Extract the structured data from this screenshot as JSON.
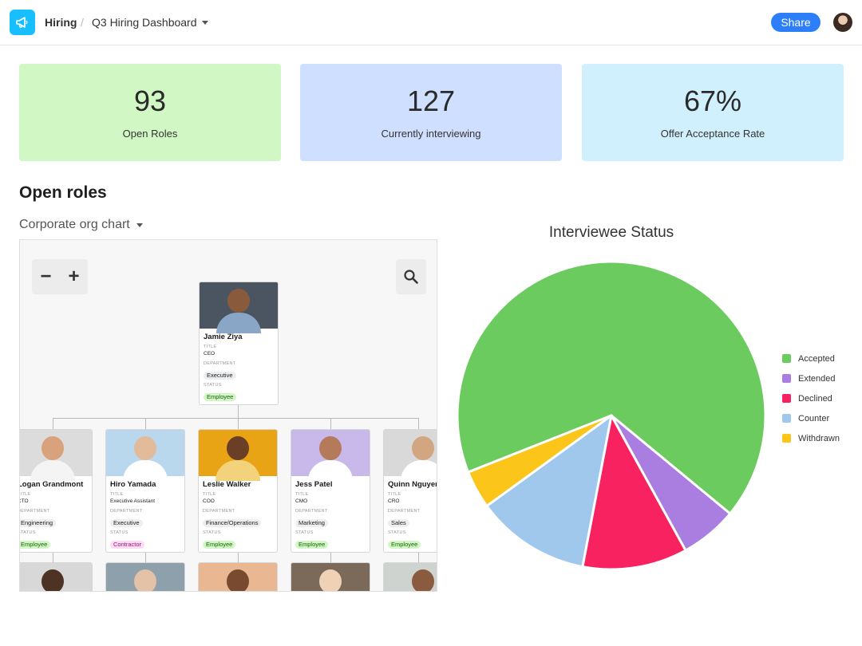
{
  "header": {
    "base_name": "Hiring",
    "separator": "/",
    "page_name": "Q3 Hiring Dashboard",
    "share_label": "Share"
  },
  "stats": [
    {
      "value": "93",
      "label": "Open Roles",
      "color": "#d1f7c4"
    },
    {
      "value": "127",
      "label": "Currently interviewing",
      "color": "#cfdfff"
    },
    {
      "value": "67%",
      "label": "Offer Acceptance Rate",
      "color": "#d0f0fd"
    }
  ],
  "section": {
    "title": "Open roles",
    "view_select": "Corporate org chart"
  },
  "org_chart": {
    "zoom_out": "−",
    "zoom_in": "+",
    "field_labels": {
      "title": "TITLE",
      "department": "DEPARTMENT",
      "status": "STATUS"
    },
    "root": {
      "name": "Jamie Ziya",
      "title": "CEO",
      "department": "Executive",
      "status": "Employee"
    },
    "reports": [
      {
        "name": "Logan Grandmont",
        "title": "CTO",
        "department": "Engineering",
        "status": "Employee"
      },
      {
        "name": "Hiro Yamada",
        "title": "Executive Assistant",
        "department": "Executive",
        "status": "Contractor"
      },
      {
        "name": "Leslie Walker",
        "title": "COO",
        "department": "Finance/Operations",
        "status": "Employee"
      },
      {
        "name": "Jess Patel",
        "title": "CMO",
        "department": "Marketing",
        "status": "Employee"
      },
      {
        "name": "Quinn Nguyen",
        "title": "CRO",
        "department": "Sales",
        "status": "Employee"
      }
    ]
  },
  "chart_data": {
    "type": "pie",
    "title": "Interviewee Status",
    "categories": [
      "Accepted",
      "Extended",
      "Declined",
      "Counter",
      "Withdrawn"
    ],
    "values": [
      67,
      6,
      11,
      12,
      4
    ],
    "colors": [
      "#6bcb5e",
      "#a97ee0",
      "#f82260",
      "#9fc8ec",
      "#fbc51a"
    ],
    "legend_position": "right"
  }
}
